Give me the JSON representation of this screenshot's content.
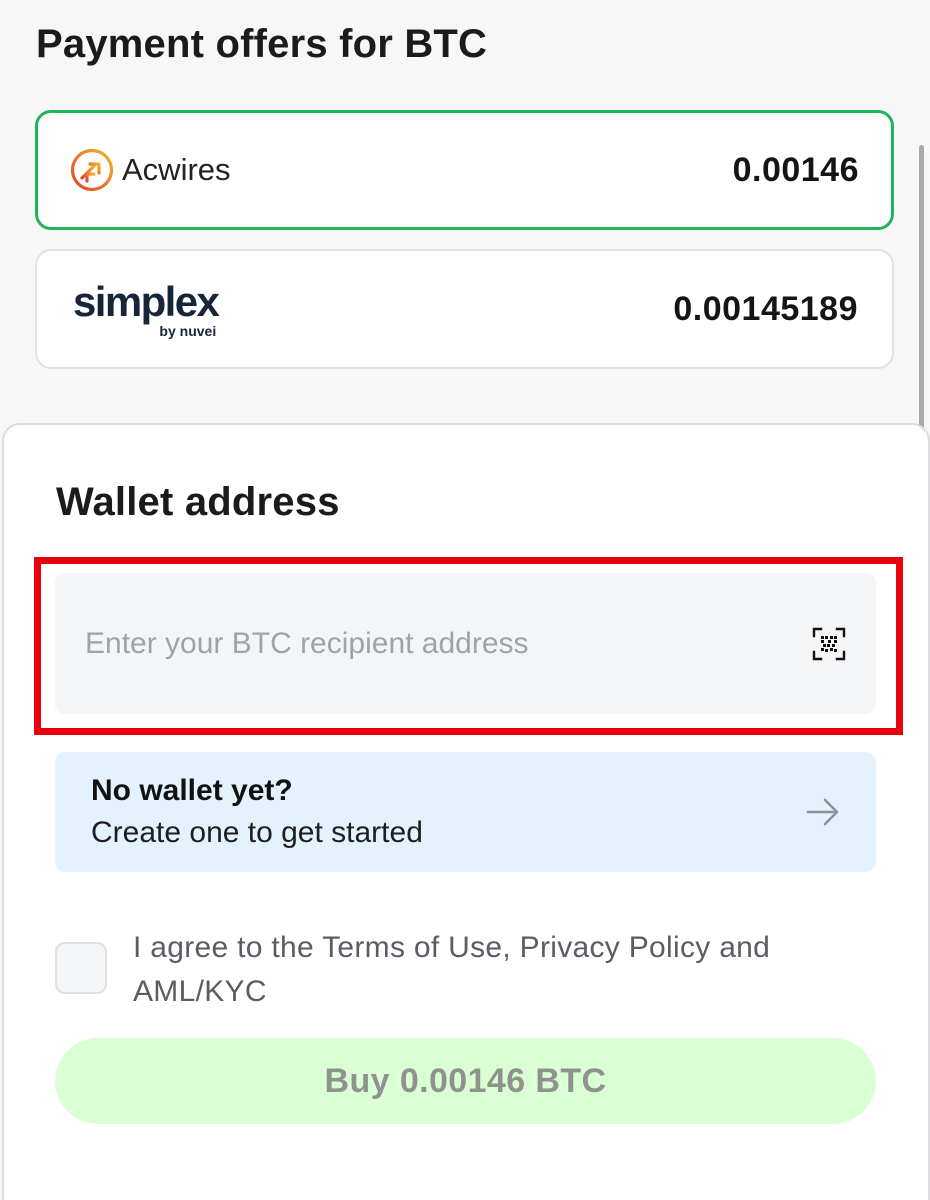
{
  "header": {
    "title": "Payment offers for BTC"
  },
  "offers": [
    {
      "provider": "Acwires",
      "amount": "0.00146",
      "selected": true
    },
    {
      "provider": "simplex",
      "provider_sub": "by nuvei",
      "amount": "0.00145189",
      "selected": false
    }
  ],
  "wallet": {
    "title": "Wallet address",
    "input_placeholder": "Enter your BTC recipient address",
    "input_value": "",
    "qr_icon": "qr-scan-icon"
  },
  "promo": {
    "title": "No wallet yet?",
    "subtitle": "Create one to get started",
    "icon": "arrow-right-icon"
  },
  "agreement": {
    "checked": false,
    "text": "I agree to the Terms of Use, Privacy Policy and AML/KYC"
  },
  "buy_button": {
    "label": "Buy 0.00146 BTC",
    "enabled": false
  },
  "colors": {
    "selected_border": "#22b35e",
    "highlight": "#e8000c",
    "promo_bg": "#e3f2fd",
    "button_bg": "#dbffd4",
    "simplex_brand": "#16253a"
  }
}
